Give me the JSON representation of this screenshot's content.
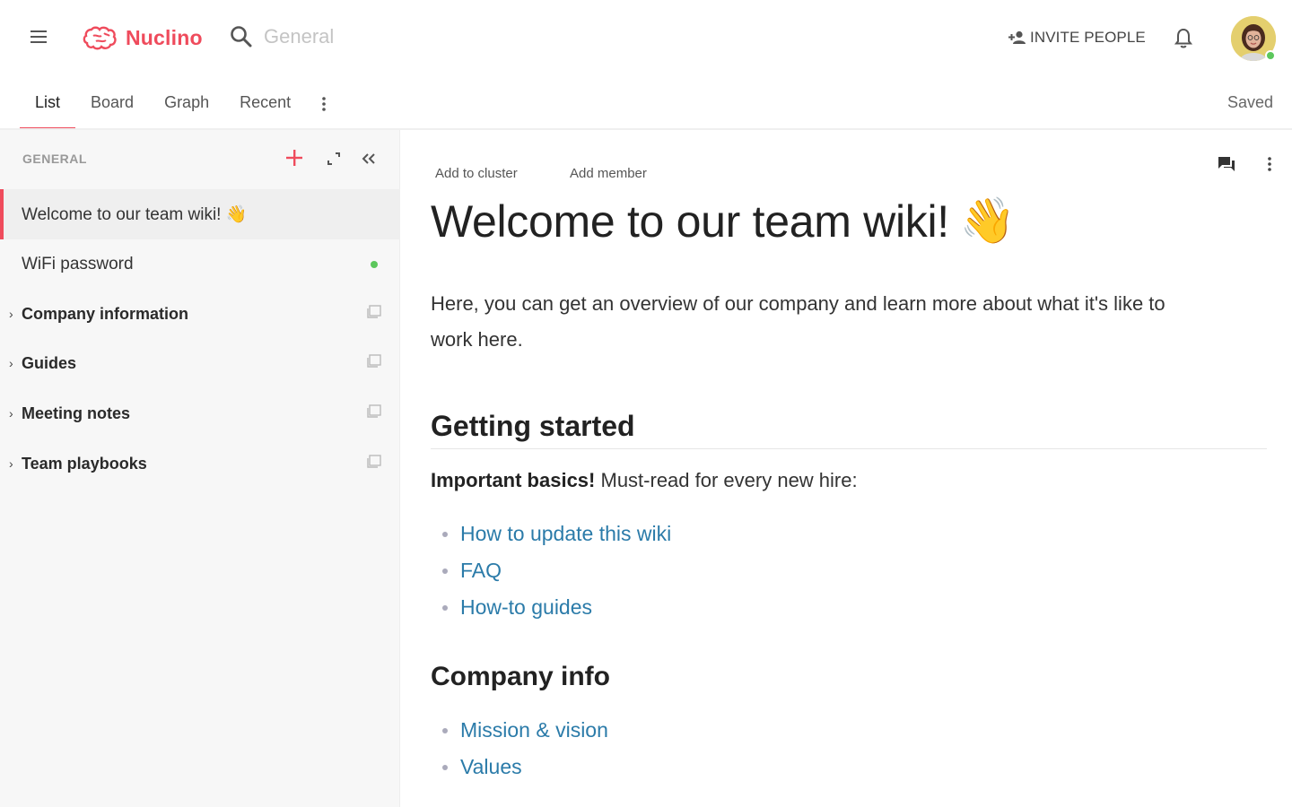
{
  "app": {
    "name": "Nuclino",
    "brand_color": "#ef4b5c",
    "link_color": "#2b7ba9",
    "online_color": "#5cc75c"
  },
  "header": {
    "menu_icon": "hamburger-icon",
    "search_placeholder": "General",
    "invite_label": "INVITE PEOPLE",
    "bell_icon": "bell-icon"
  },
  "tabs": [
    {
      "label": "List",
      "active": true
    },
    {
      "label": "Board",
      "active": false
    },
    {
      "label": "Graph",
      "active": false
    },
    {
      "label": "Recent",
      "active": false
    }
  ],
  "status": "Saved",
  "sidebar": {
    "heading": "GENERAL",
    "items": [
      {
        "label": "Welcome to our team wiki! 👋",
        "selected": true,
        "type": "item"
      },
      {
        "label": "WiFi password",
        "type": "item",
        "online": true
      },
      {
        "label": "Company information",
        "type": "cluster"
      },
      {
        "label": "Guides",
        "type": "cluster"
      },
      {
        "label": "Meeting notes",
        "type": "cluster"
      },
      {
        "label": "Team playbooks",
        "type": "cluster"
      }
    ]
  },
  "document": {
    "add_to_cluster": "Add to cluster",
    "add_member": "Add member",
    "title": "Welcome to our team wiki!",
    "title_emoji": "👋",
    "intro": "Here, you can get an overview of our company and learn more about what it's like to work here.",
    "section1_heading": "Getting started",
    "section1_bold": "Important basics!",
    "section1_text": " Must-read for every new hire:",
    "section1_links": [
      "How to update this wiki",
      "FAQ",
      "How-to guides"
    ],
    "section2_heading": "Company info",
    "section2_links": [
      "Mission & vision",
      "Values"
    ]
  }
}
